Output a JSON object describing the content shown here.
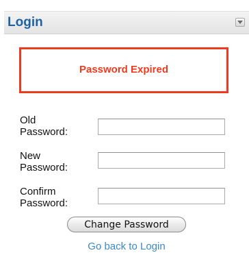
{
  "panel": {
    "title": "Login",
    "collapse_icon": "chevron-down-icon",
    "title_color": "#1e62a6"
  },
  "alert": {
    "message": "Password Expired",
    "color": "#ee3a1e"
  },
  "form": {
    "old_password": {
      "label": "Old\nPassword:",
      "value": ""
    },
    "new_password": {
      "label": "New\nPassword:",
      "value": ""
    },
    "confirm_password": {
      "label": "Confirm\nPassword:",
      "value": ""
    },
    "submit_label": "Change Password",
    "back_link_label": "Go back to Login",
    "link_color": "#3b8ac8"
  }
}
